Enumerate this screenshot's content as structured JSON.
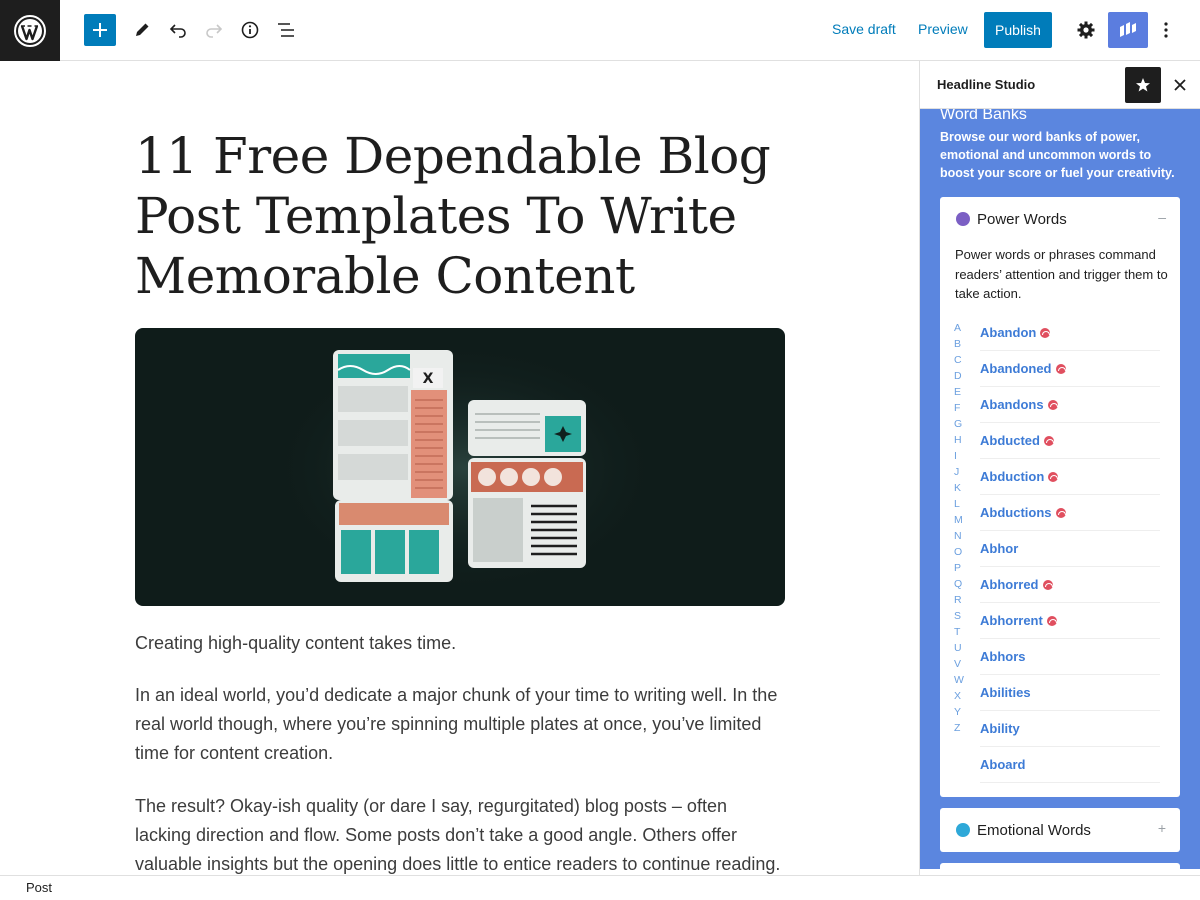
{
  "toolbar": {
    "save_draft": "Save draft",
    "preview": "Preview",
    "publish": "Publish"
  },
  "post": {
    "title": "11 Free Dependable Blog Post Templates To Write Memorable Content",
    "paragraphs": [
      "Creating high-quality content takes time.",
      "In an ideal world, you’d dedicate a major chunk of your time to writing well. In the real world though, where you’re spinning multiple plates at once, you’ve limited time for content creation.",
      "The result? Okay-ish quality (or dare I say, regurgitated) blog posts – often lacking direction and flow. Some posts don’t take a good angle. Others offer valuable insights but the opening does little to entice readers to continue reading."
    ]
  },
  "statusbar": {
    "label": "Post"
  },
  "sidebar": {
    "title": "Headline Studio",
    "word_banks_title": "Word Banks",
    "word_banks_desc": "Browse our word banks of power, emotional and uncommon words to boost your score or fuel your creativity.",
    "power": {
      "title": "Power Words",
      "toggle": "–",
      "desc": "Power words or phrases command readers’ attention and trigger them to take action.",
      "letters": [
        "A",
        "B",
        "C",
        "D",
        "E",
        "F",
        "G",
        "H",
        "I",
        "J",
        "K",
        "L",
        "M",
        "N",
        "O",
        "P",
        "Q",
        "R",
        "S",
        "T",
        "U",
        "V",
        "W",
        "X",
        "Y",
        "Z"
      ],
      "words": [
        {
          "text": "Abandon",
          "negative": true
        },
        {
          "text": "Abandoned",
          "negative": true
        },
        {
          "text": "Abandons",
          "negative": true
        },
        {
          "text": "Abducted",
          "negative": true
        },
        {
          "text": "Abduction",
          "negative": true
        },
        {
          "text": "Abductions",
          "negative": true
        },
        {
          "text": "Abhor",
          "negative": false
        },
        {
          "text": "Abhorred",
          "negative": true
        },
        {
          "text": "Abhorrent",
          "negative": true
        },
        {
          "text": "Abhors",
          "negative": false
        },
        {
          "text": "Abilities",
          "negative": false
        },
        {
          "text": "Ability",
          "negative": false
        },
        {
          "text": "Aboard",
          "negative": false
        }
      ]
    },
    "emotional": {
      "title": "Emotional Words",
      "toggle": "+"
    }
  },
  "colors": {
    "accent": "#007cba",
    "sidebar_bg": "#5b86df",
    "word_link": "#3d7bd6",
    "negative_badge": "#e04f5f"
  }
}
